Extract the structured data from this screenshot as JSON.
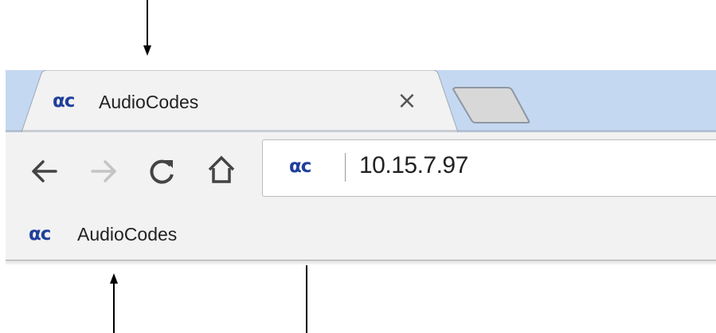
{
  "tab": {
    "icon": "audiocodes-logo-icon",
    "icon_text": "αc",
    "title": "AudioCodes",
    "close_label": "×"
  },
  "toolbar": {
    "back_icon": "back-arrow-icon",
    "forward_icon": "forward-arrow-icon",
    "reload_icon": "reload-icon",
    "home_icon": "home-icon"
  },
  "omnibox": {
    "site_icon": "audiocodes-logo-icon",
    "site_icon_text": "αc",
    "url": "10.15.7.97"
  },
  "bookmarks": [
    {
      "icon": "audiocodes-logo-icon",
      "icon_text": "αc",
      "label": "AudioCodes"
    }
  ],
  "colors": {
    "brand": "#1f3f9a",
    "tabstrip": "#c5d8f1",
    "toolbar": "#f2f2f2"
  }
}
